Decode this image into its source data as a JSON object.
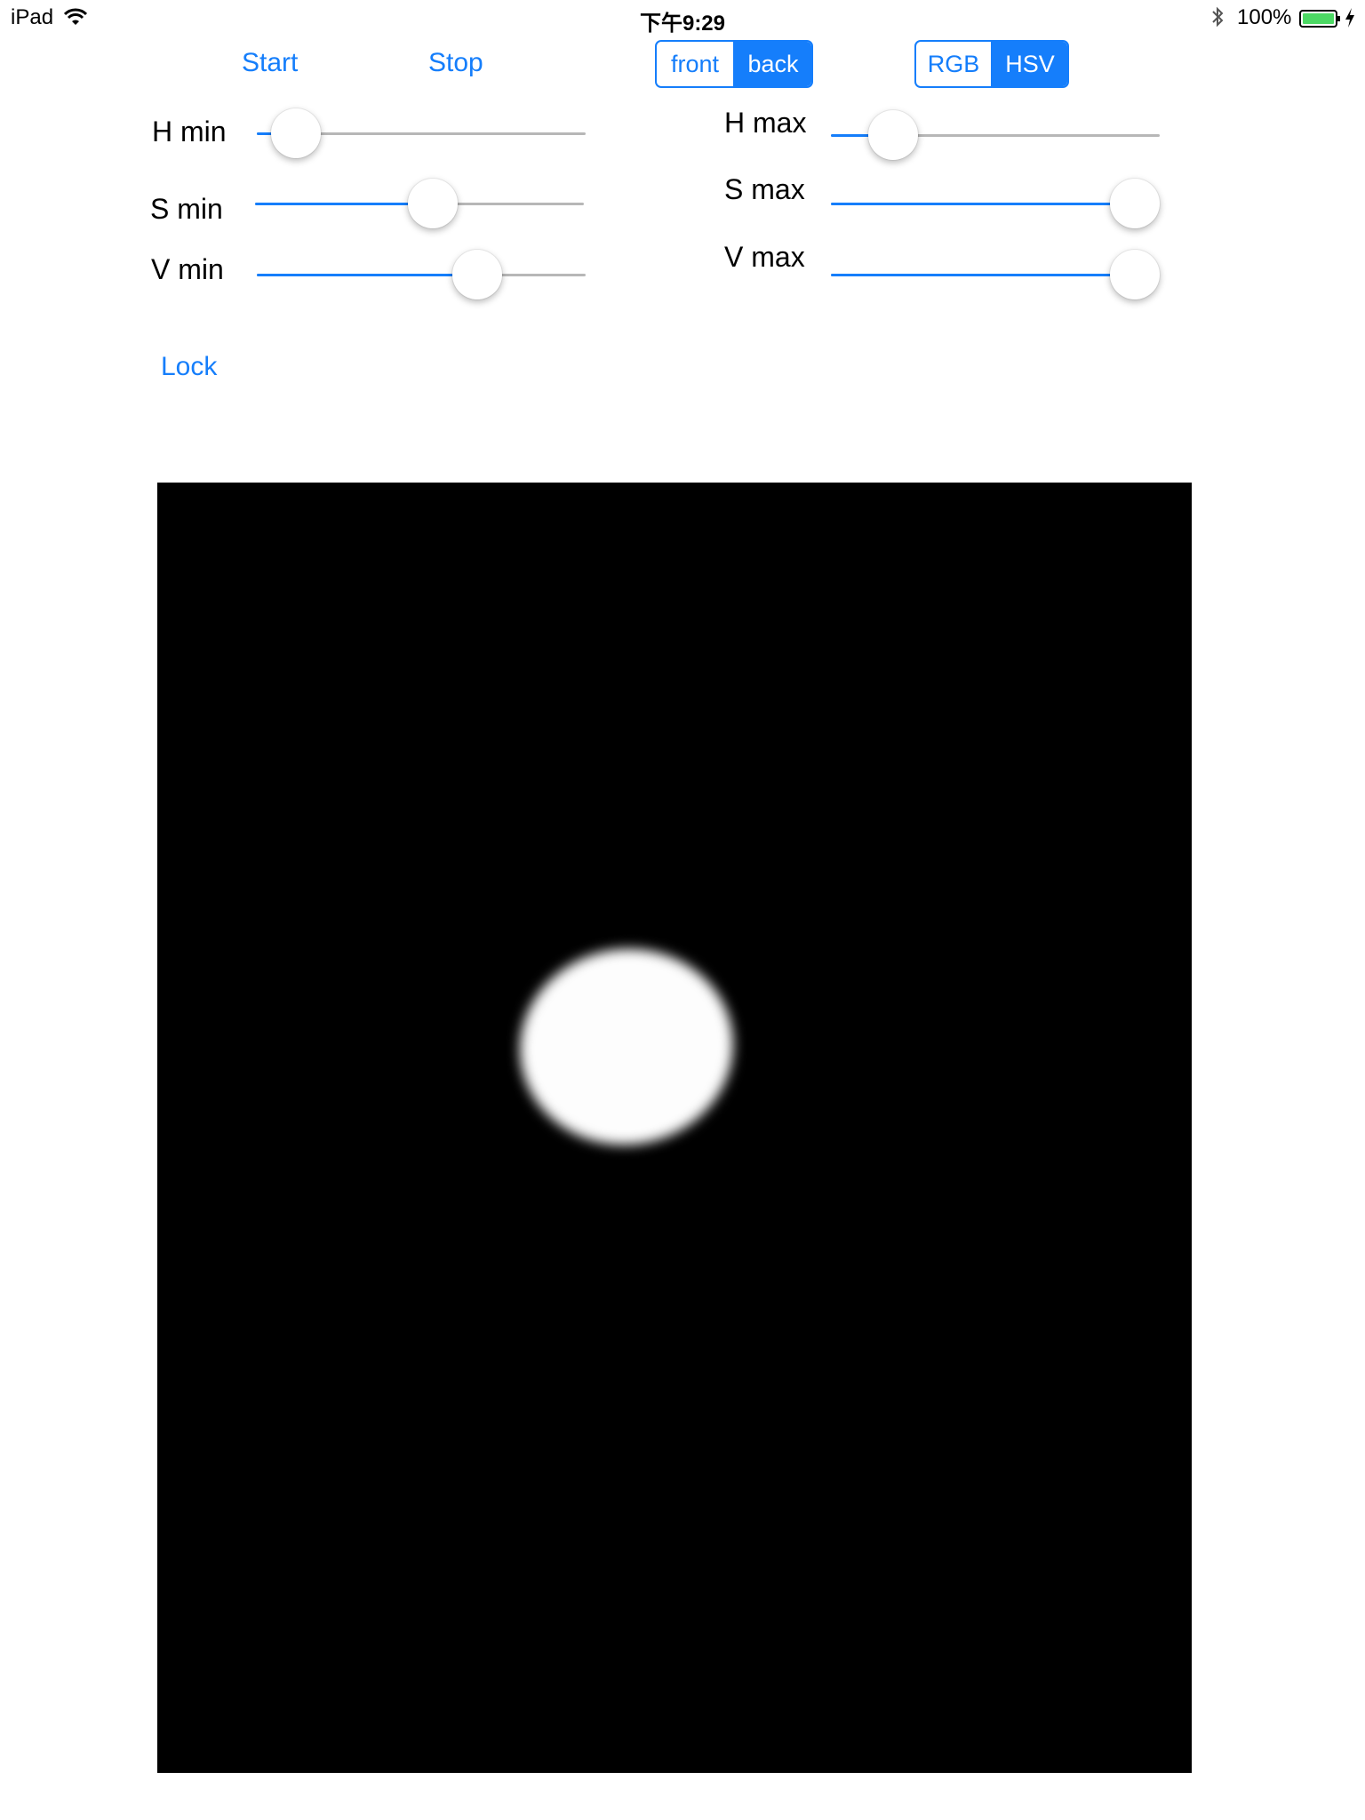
{
  "status_bar": {
    "device": "iPad",
    "time": "下午9:29",
    "battery": "100%",
    "icons": [
      "wifi-icon",
      "bluetooth-icon",
      "battery-icon",
      "charging-icon"
    ]
  },
  "controls": {
    "start_label": "Start",
    "stop_label": "Stop",
    "lock_label": "Lock",
    "camera_segment": {
      "options": [
        "front",
        "back"
      ],
      "selected": "back"
    },
    "color_segment": {
      "options": [
        "RGB",
        "HSV"
      ],
      "selected": "HSV"
    }
  },
  "sliders": {
    "h_min": {
      "label": "H min",
      "value": 0.12
    },
    "s_min": {
      "label": "S min",
      "value": 0.54
    },
    "v_min": {
      "label": "V min",
      "value": 0.67
    },
    "h_max": {
      "label": "H max",
      "value": 0.19
    },
    "s_max": {
      "label": "S max",
      "value": 1.0
    },
    "v_max": {
      "label": "V max",
      "value": 1.0
    }
  },
  "colors": {
    "accent": "#157efb",
    "track": "#b7b7b7",
    "preview_background": "#000000",
    "blob": "#fdfdfd",
    "battery": "#4cd964"
  }
}
